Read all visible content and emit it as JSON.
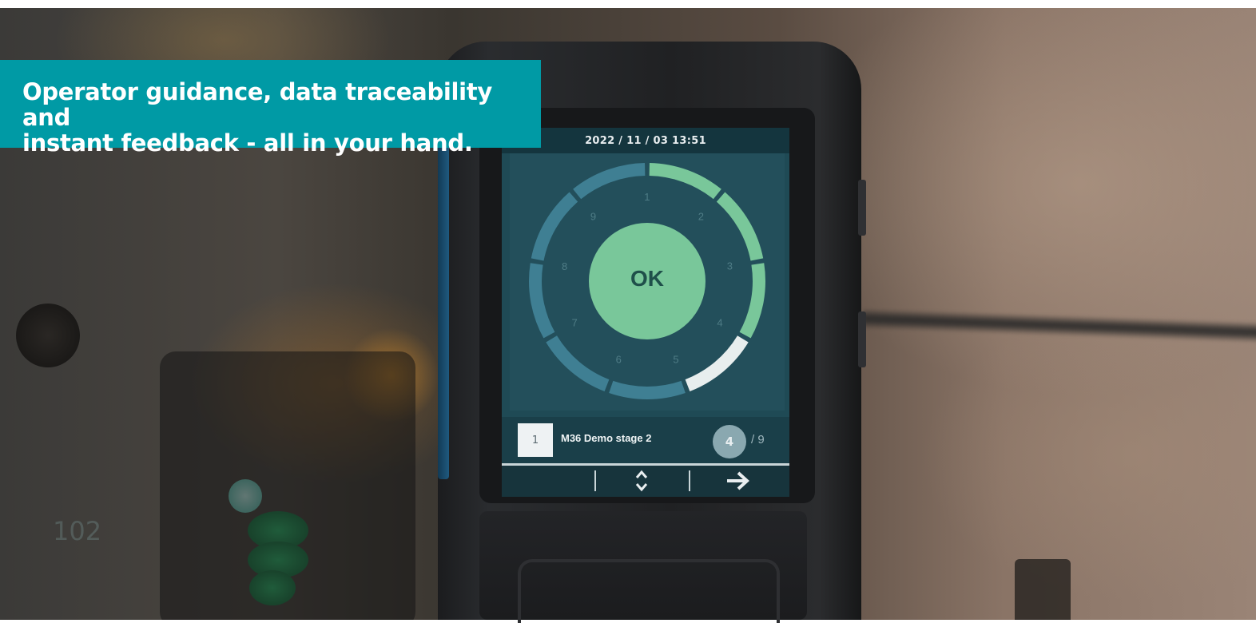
{
  "banner": {
    "line1": "Operator guidance, data traceability and",
    "line2": "instant feedback - all in your hand."
  },
  "device": {
    "datetime": "2022 / 11 / 03  13:51",
    "result": "OK",
    "ring_numbers": [
      "1",
      "2",
      "3",
      "4",
      "5",
      "6",
      "7",
      "8",
      "9"
    ],
    "stage_number": "1",
    "stage_name": "M36 Demo stage 2",
    "current_count": "4",
    "total_count": "/ 9",
    "colors": {
      "ok_green": "#79c79a",
      "ring_teal": "#3f7f93",
      "screen_bg": "#1f4a55"
    }
  },
  "page_number": "102",
  "colors": {
    "banner": "#009aa5"
  }
}
